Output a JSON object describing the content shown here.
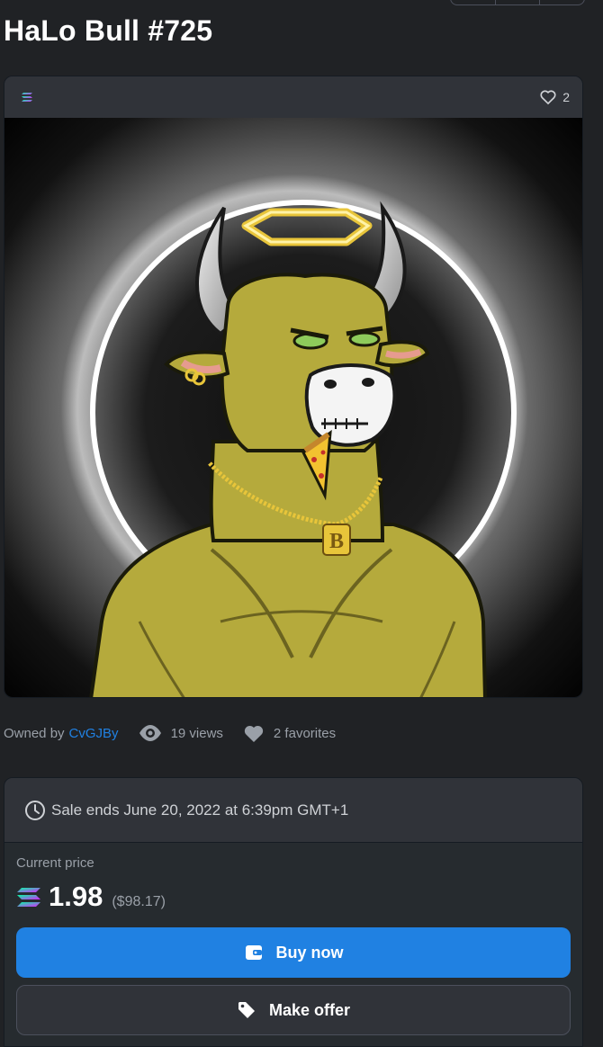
{
  "item": {
    "title": "HaLo Bull #725",
    "favorite_count": "2",
    "chain_icon": "solana-icon"
  },
  "meta": {
    "owned_by_label": "Owned by",
    "owner": "CvGJBy",
    "views": "19 views",
    "favorites": "2 favorites"
  },
  "sale": {
    "ends_text": "Sale ends June 20, 2022 at 6:39pm GMT+1",
    "current_price_label": "Current price",
    "price": "1.98",
    "price_usd": "($98.17)",
    "buy_label": "Buy now",
    "offer_label": "Make offer"
  },
  "colors": {
    "background": "#202225",
    "accent": "#2081e2",
    "card": "#303339",
    "bull_skin": "#b7ac3e",
    "halo": "#e8c53a"
  }
}
